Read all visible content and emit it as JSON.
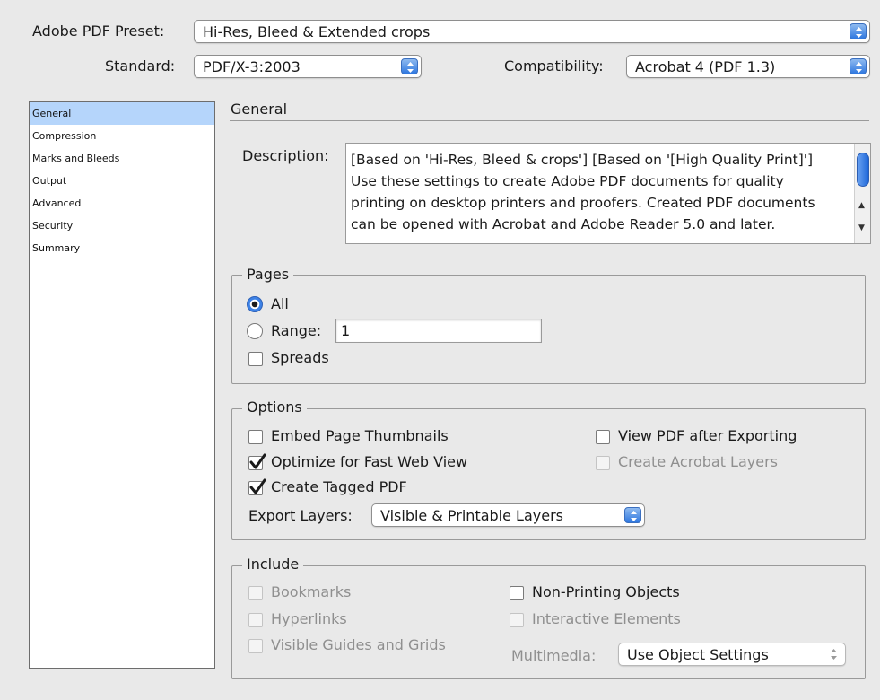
{
  "preset": {
    "label": "Adobe PDF Preset:",
    "value": "Hi-Res, Bleed & Extended crops"
  },
  "standard": {
    "label": "Standard:",
    "value": "PDF/X-3:2003"
  },
  "compatibility": {
    "label": "Compatibility:",
    "value": "Acrobat 4 (PDF 1.3)"
  },
  "sidebar": {
    "items": [
      {
        "label": "General",
        "selected": true
      },
      {
        "label": "Compression"
      },
      {
        "label": "Marks and Bleeds"
      },
      {
        "label": "Output"
      },
      {
        "label": "Advanced"
      },
      {
        "label": "Security"
      },
      {
        "label": "Summary"
      }
    ]
  },
  "main": {
    "heading": "General",
    "description_label": "Description:",
    "description": "[Based on 'Hi-Res, Bleed & crops'] [Based on '[High Quality Print]'] Use these settings to create Adobe PDF documents for quality printing on desktop printers and proofers. Created PDF documents can be opened with Acrobat and Adobe Reader 5.0 and later."
  },
  "pages": {
    "title": "Pages",
    "all_label": "All",
    "range_label": "Range:",
    "range_value": "1",
    "spreads_label": "Spreads",
    "selected": "All",
    "spreads_checked": false
  },
  "options": {
    "title": "Options",
    "embed_thumbnails": {
      "label": "Embed Page Thumbnails",
      "checked": false
    },
    "optimize_web": {
      "label": "Optimize for Fast Web View",
      "checked": true
    },
    "tagged_pdf": {
      "label": "Create Tagged PDF",
      "checked": true
    },
    "view_after": {
      "label": "View PDF after Exporting",
      "checked": false
    },
    "acrobat_layers": {
      "label": "Create Acrobat Layers",
      "checked": false,
      "disabled": true
    },
    "export_layers_label": "Export Layers:",
    "export_layers_value": "Visible & Printable Layers"
  },
  "include": {
    "title": "Include",
    "bookmarks": {
      "label": "Bookmarks",
      "disabled": true
    },
    "hyperlinks": {
      "label": "Hyperlinks",
      "disabled": true
    },
    "guides": {
      "label": "Visible Guides and Grids",
      "disabled": true
    },
    "non_printing": {
      "label": "Non-Printing Objects",
      "checked": false
    },
    "interactive": {
      "label": "Interactive Elements",
      "disabled": true
    },
    "multimedia_label": "Multimedia:",
    "multimedia_value": "Use Object Settings"
  },
  "colors": {
    "selection": "#b5d5fb",
    "accent": "#2f78e0",
    "background": "#e9e9e9"
  }
}
